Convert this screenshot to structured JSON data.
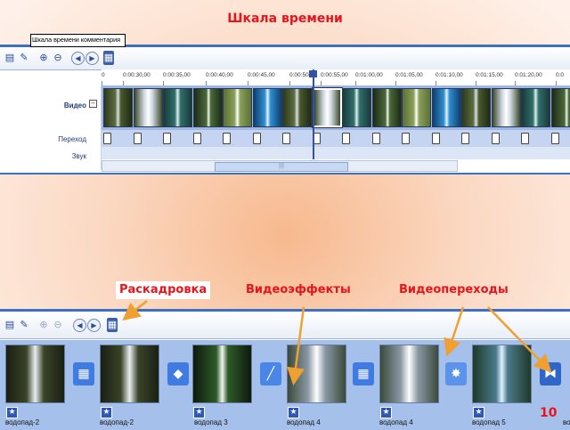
{
  "heading_timeline": "Шкала времени",
  "tooltip": "Шкала времени комментария",
  "ruler_ticks": [
    "0",
    "0:00:30,00",
    "0:00:35,00",
    "0:00:40,00",
    "0:00:45,00",
    "0:00:50,00",
    "0:00:55,00",
    "0:01:00,00",
    "0:01:05,00",
    "0:01:10,00",
    "0:01:15,00",
    "0:01:20,00",
    "0:0"
  ],
  "tracks": {
    "video": "Видео",
    "transition": "Переход",
    "audio": "Звук",
    "collapse": "−"
  },
  "scroll_grip": "|||",
  "captions": {
    "storyboard": "Раскадровка",
    "effects": "Видеоэффекты",
    "transitions": "Видеопереходы"
  },
  "storyboard_clips": [
    "водопад-2",
    "водопад-2",
    "водопад 3",
    "водопад 4",
    "водопад 4",
    "водопад 5",
    "во"
  ],
  "page_number": "10",
  "colors": {
    "accent_red": "#e8141b",
    "panel_blue": "#3d6fc2",
    "arrow_orange": "#f0a030"
  },
  "icons": [
    "storyboard-icon",
    "narrate-icon",
    "zoom-in-icon",
    "zoom-out-icon",
    "rewind-icon",
    "play-icon",
    "filmstrip-icon",
    "star-icon"
  ]
}
